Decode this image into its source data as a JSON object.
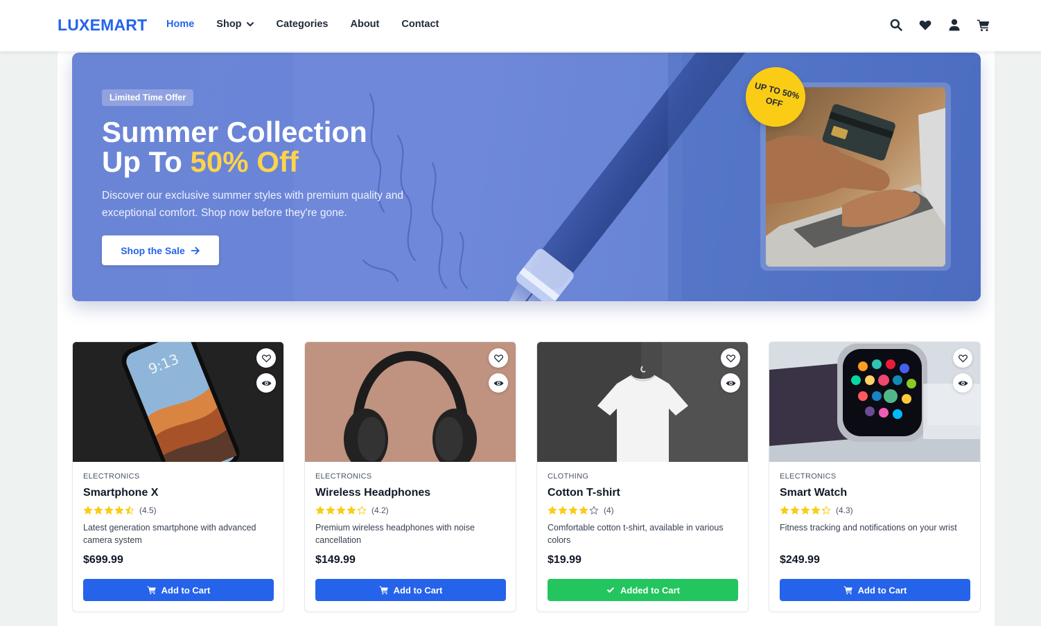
{
  "brand": {
    "logo": "LUXEMART",
    "accent": "#2563eb"
  },
  "nav": {
    "items": [
      {
        "label": "Home",
        "active": true
      },
      {
        "label": "Shop",
        "dropdown": true
      },
      {
        "label": "Categories"
      },
      {
        "label": "About"
      },
      {
        "label": "Contact"
      }
    ]
  },
  "header_icons": [
    "search-icon",
    "heart-icon",
    "user-icon",
    "cart-icon"
  ],
  "hero": {
    "badge": "Limited Time Offer",
    "title_line1": "Summer Collection",
    "title_line2_prefix": "Up To ",
    "title_line2_highlight": "50% Off",
    "description": "Discover our exclusive summer styles with premium quality and exceptional comfort. Shop now before they're gone.",
    "button_label": "Shop the Sale",
    "promo_line1": "UP TO 50%",
    "promo_line2": "OFF"
  },
  "products": [
    {
      "category": "ELECTRONICS",
      "name": "Smartphone X",
      "rating": 4.5,
      "rating_text": "(4.5)",
      "description": "Latest generation smartphone with advanced camera system",
      "price": "$699.99",
      "button_label": "Add to Cart",
      "added": false,
      "image": "smartphone"
    },
    {
      "category": "ELECTRONICS",
      "name": "Wireless Headphones",
      "rating": 4.2,
      "rating_text": "(4.2)",
      "description": "Premium wireless headphones with noise cancellation",
      "price": "$149.99",
      "button_label": "Add to Cart",
      "added": false,
      "image": "headphones"
    },
    {
      "category": "CLOTHING",
      "name": "Cotton T-shirt",
      "rating": 4,
      "rating_text": "(4)",
      "description": "Comfortable cotton t-shirt, available in various colors",
      "price": "$19.99",
      "button_label": "Added to Cart",
      "added": true,
      "image": "tshirt"
    },
    {
      "category": "ELECTRONICS",
      "name": "Smart Watch",
      "rating": 4.3,
      "rating_text": "(4.3)",
      "description": "Fitness tracking and notifications on your wrist",
      "price": "$249.99",
      "button_label": "Add to Cart",
      "added": false,
      "image": "smartwatch"
    }
  ],
  "colors": {
    "primary_button": "#2563eb",
    "added_button": "#22c55e",
    "star": "#facc15",
    "promo": "#facc15",
    "highlight": "#fcd34d"
  }
}
